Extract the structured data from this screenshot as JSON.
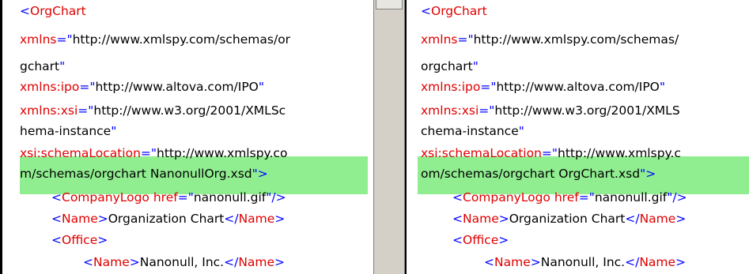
{
  "left": {
    "lines": [
      [
        {
          "c": "blue",
          "t": "<"
        },
        {
          "c": "red",
          "t": "OrgChart"
        }
      ],
      [
        {
          "c": "red",
          "t": "xmlns"
        },
        {
          "c": "blue",
          "t": "=\""
        },
        {
          "c": "blk",
          "t": "http://www.xmlspy.com/schemas/or"
        }
      ],
      [
        {
          "c": "blk",
          "t": "gchart"
        },
        {
          "c": "blue",
          "t": "\""
        }
      ],
      [
        {
          "c": "red",
          "t": "xmlns:ipo"
        },
        {
          "c": "blue",
          "t": "=\""
        },
        {
          "c": "blk",
          "t": "http://www.altova.com/IPO"
        },
        {
          "c": "blue",
          "t": "\""
        }
      ],
      [
        {
          "c": "red",
          "t": "xmlns:xsi"
        },
        {
          "c": "blue",
          "t": "=\""
        },
        {
          "c": "blk",
          "t": "http://www.w3.org/2001/XMLSc"
        }
      ],
      [
        {
          "c": "blk",
          "t": "hema-instance"
        },
        {
          "c": "blue",
          "t": "\""
        }
      ],
      [
        {
          "c": "red",
          "t": "xsi:schemaLocation"
        },
        {
          "c": "blue",
          "t": "=\""
        },
        {
          "c": "blk",
          "t": "http://www.xmlspy.co"
        }
      ],
      [
        {
          "c": "blk",
          "t": "m/schemas/orgchart NanonullOrg.xsd"
        },
        {
          "c": "blue",
          "t": "\">"
        }
      ],
      [
        {
          "c": "blue",
          "t": "<"
        },
        {
          "c": "red",
          "t": "CompanyLogo"
        },
        {
          "c": "blk",
          "t": " "
        },
        {
          "c": "red",
          "t": "href"
        },
        {
          "c": "blue",
          "t": "=\""
        },
        {
          "c": "blk",
          "t": "nanonull.gif"
        },
        {
          "c": "blue",
          "t": "\"/>"
        }
      ],
      [
        {
          "c": "blue",
          "t": "<"
        },
        {
          "c": "red",
          "t": "Name"
        },
        {
          "c": "blue",
          "t": ">"
        },
        {
          "c": "blk",
          "t": "Organization Chart"
        },
        {
          "c": "blue",
          "t": "</"
        },
        {
          "c": "red",
          "t": "Name"
        },
        {
          "c": "blue",
          "t": ">"
        }
      ],
      [
        {
          "c": "blue",
          "t": "<"
        },
        {
          "c": "red",
          "t": "Office"
        },
        {
          "c": "blue",
          "t": ">"
        }
      ],
      [
        {
          "c": "blue",
          "t": "<"
        },
        {
          "c": "red",
          "t": "Name"
        },
        {
          "c": "blue",
          "t": ">"
        },
        {
          "c": "blk",
          "t": "Nanonull, Inc."
        },
        {
          "c": "blue",
          "t": "</"
        },
        {
          "c": "red",
          "t": "Name"
        },
        {
          "c": "blue",
          "t": ">"
        }
      ]
    ]
  },
  "right": {
    "lines": [
      [
        {
          "c": "blue",
          "t": "<"
        },
        {
          "c": "red",
          "t": "OrgChart"
        }
      ],
      [
        {
          "c": "red",
          "t": "xmlns"
        },
        {
          "c": "blue",
          "t": "=\""
        },
        {
          "c": "blk",
          "t": "http://www.xmlspy.com/schemas/"
        }
      ],
      [
        {
          "c": "blk",
          "t": "orgchart"
        },
        {
          "c": "blue",
          "t": "\""
        }
      ],
      [
        {
          "c": "red",
          "t": "xmlns:ipo"
        },
        {
          "c": "blue",
          "t": "=\""
        },
        {
          "c": "blk",
          "t": "http://www.altova.com/IPO"
        },
        {
          "c": "blue",
          "t": "\""
        }
      ],
      [
        {
          "c": "red",
          "t": "xmlns:xsi"
        },
        {
          "c": "blue",
          "t": "=\""
        },
        {
          "c": "blk",
          "t": "http://www.w3.org/2001/XMLS"
        }
      ],
      [
        {
          "c": "blk",
          "t": "chema-instance"
        },
        {
          "c": "blue",
          "t": "\""
        }
      ],
      [
        {
          "c": "red",
          "t": "xsi:schemaLocation"
        },
        {
          "c": "blue",
          "t": "=\""
        },
        {
          "c": "blk",
          "t": "http://www.xmlspy.c"
        }
      ],
      [
        {
          "c": "blk",
          "t": "om/schemas/orgchart OrgChart.xsd"
        },
        {
          "c": "blue",
          "t": "\">"
        }
      ],
      [
        {
          "c": "blue",
          "t": "<"
        },
        {
          "c": "red",
          "t": "CompanyLogo"
        },
        {
          "c": "blk",
          "t": " "
        },
        {
          "c": "red",
          "t": "href"
        },
        {
          "c": "blue",
          "t": "=\""
        },
        {
          "c": "blk",
          "t": "nanonull.gif"
        },
        {
          "c": "blue",
          "t": "\"/>"
        }
      ],
      [
        {
          "c": "blue",
          "t": "<"
        },
        {
          "c": "red",
          "t": "Name"
        },
        {
          "c": "blue",
          "t": ">"
        },
        {
          "c": "blk",
          "t": "Organization Chart"
        },
        {
          "c": "blue",
          "t": "</"
        },
        {
          "c": "red",
          "t": "Name"
        },
        {
          "c": "blue",
          "t": ">"
        }
      ],
      [
        {
          "c": "blue",
          "t": "<"
        },
        {
          "c": "red",
          "t": "Office"
        },
        {
          "c": "blue",
          "t": ">"
        }
      ],
      [
        {
          "c": "blue",
          "t": "<"
        },
        {
          "c": "red",
          "t": "Name"
        },
        {
          "c": "blue",
          "t": ">"
        },
        {
          "c": "blk",
          "t": "Nanonull, Inc."
        },
        {
          "c": "blue",
          "t": "</"
        },
        {
          "c": "red",
          "t": "Name"
        },
        {
          "c": "blue",
          "t": ">"
        }
      ]
    ]
  },
  "colors": {
    "tag": "#0000ff",
    "name": "#e00000",
    "text": "#000000",
    "highlight": "#90ee90",
    "scrollbar": "#d4d0c8"
  }
}
